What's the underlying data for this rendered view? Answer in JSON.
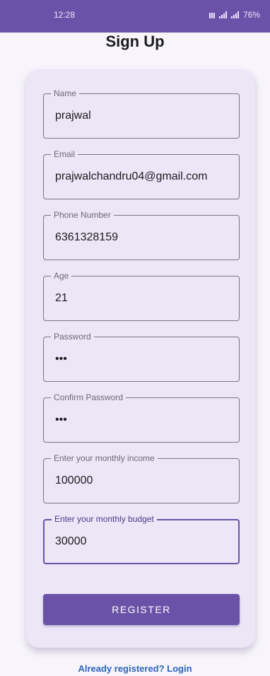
{
  "status_bar": {
    "time": "12:28",
    "battery": "76%",
    "icons": [
      "sim-icon",
      "signal-icon"
    ]
  },
  "title": "Sign Up",
  "form": {
    "name": {
      "label": "Name",
      "value": "prajwal"
    },
    "email": {
      "label": "Email",
      "value": "prajwalchandru04@gmail.com"
    },
    "phone": {
      "label": "Phone Number",
      "value": "6361328159"
    },
    "age": {
      "label": "Age",
      "value": "21"
    },
    "password": {
      "label": "Password",
      "value": "•••"
    },
    "confirm_password": {
      "label": "Confirm Password",
      "value": "•••"
    },
    "monthly_income": {
      "label": "Enter your monthly income",
      "value": "100000"
    },
    "monthly_budget": {
      "label": "Enter your monthly budget",
      "value": "30000"
    },
    "register_label": "REGISTER"
  },
  "login_link": "Already registered? Login",
  "colors": {
    "primary": "#6a52a8",
    "card_background": "#ece6f6",
    "link": "#2e64b8"
  }
}
